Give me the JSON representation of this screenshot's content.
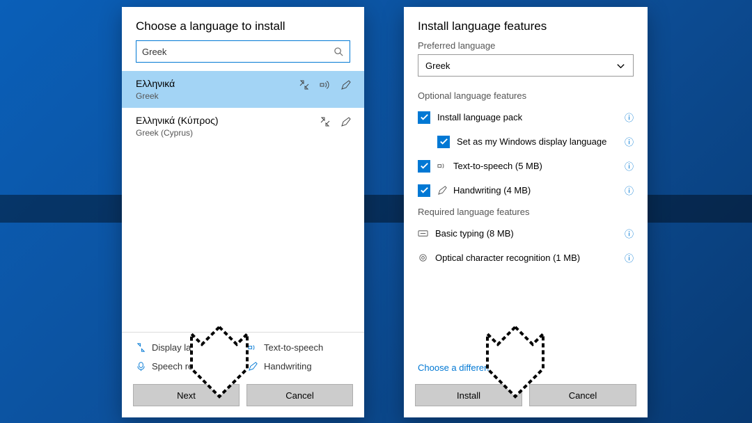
{
  "left": {
    "title": "Choose a language to install",
    "search_value": "Greek",
    "items": [
      {
        "native": "Ελληνικά",
        "english": "Greek",
        "selected": true,
        "icons": [
          "display",
          "tts",
          "hand"
        ]
      },
      {
        "native": "Ελληνικά (Κύπρος)",
        "english": "Greek (Cyprus)",
        "selected": false,
        "icons": [
          "display",
          "hand"
        ]
      }
    ],
    "legend": {
      "display": "Display language",
      "tts": "Text-to-speech",
      "speech": "Speech recognition",
      "hand": "Handwriting"
    },
    "next": "Next",
    "cancel": "Cancel"
  },
  "right": {
    "title": "Install language features",
    "preferred_label": "Preferred language",
    "preferred_value": "Greek",
    "optional_heading": "Optional language features",
    "opt_pack": "Install language pack",
    "opt_setdisplay": "Set as my Windows display language",
    "opt_tts": "Text-to-speech (5 MB)",
    "opt_hand": "Handwriting (4 MB)",
    "required_heading": "Required language features",
    "req_typing": "Basic typing (8 MB)",
    "req_ocr": "Optical character recognition (1 MB)",
    "choose_link": "Choose a different language",
    "install": "Install",
    "cancel": "Cancel"
  }
}
